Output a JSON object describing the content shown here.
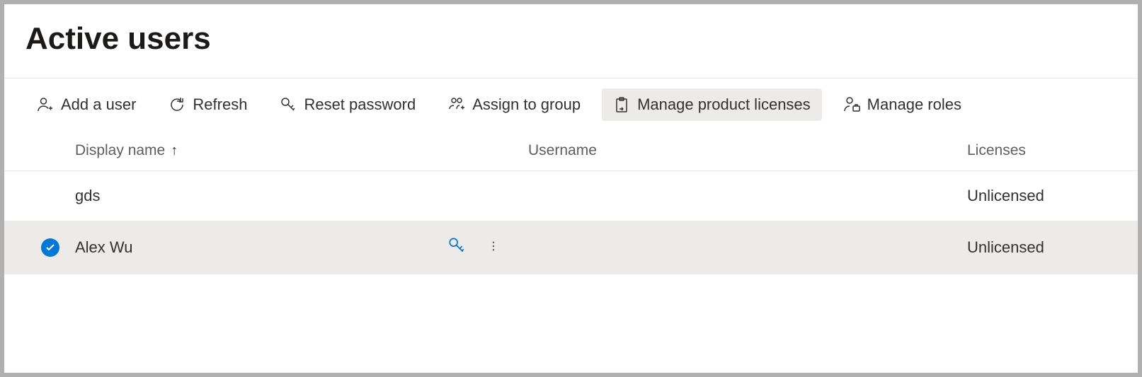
{
  "page": {
    "title": "Active users"
  },
  "toolbar": {
    "add_user": "Add a user",
    "refresh": "Refresh",
    "reset_password": "Reset password",
    "assign_to_group": "Assign to group",
    "manage_product_licenses": "Manage product licenses",
    "manage_roles": "Manage roles"
  },
  "table": {
    "headers": {
      "display_name": "Display name",
      "username": "Username",
      "licenses": "Licenses"
    },
    "sort_indicator": "↑",
    "rows": [
      {
        "display_name": "gds",
        "username": "",
        "licenses": "Unlicensed",
        "selected": false
      },
      {
        "display_name": "Alex Wu",
        "username": "",
        "licenses": "Unlicensed",
        "selected": true
      }
    ]
  }
}
